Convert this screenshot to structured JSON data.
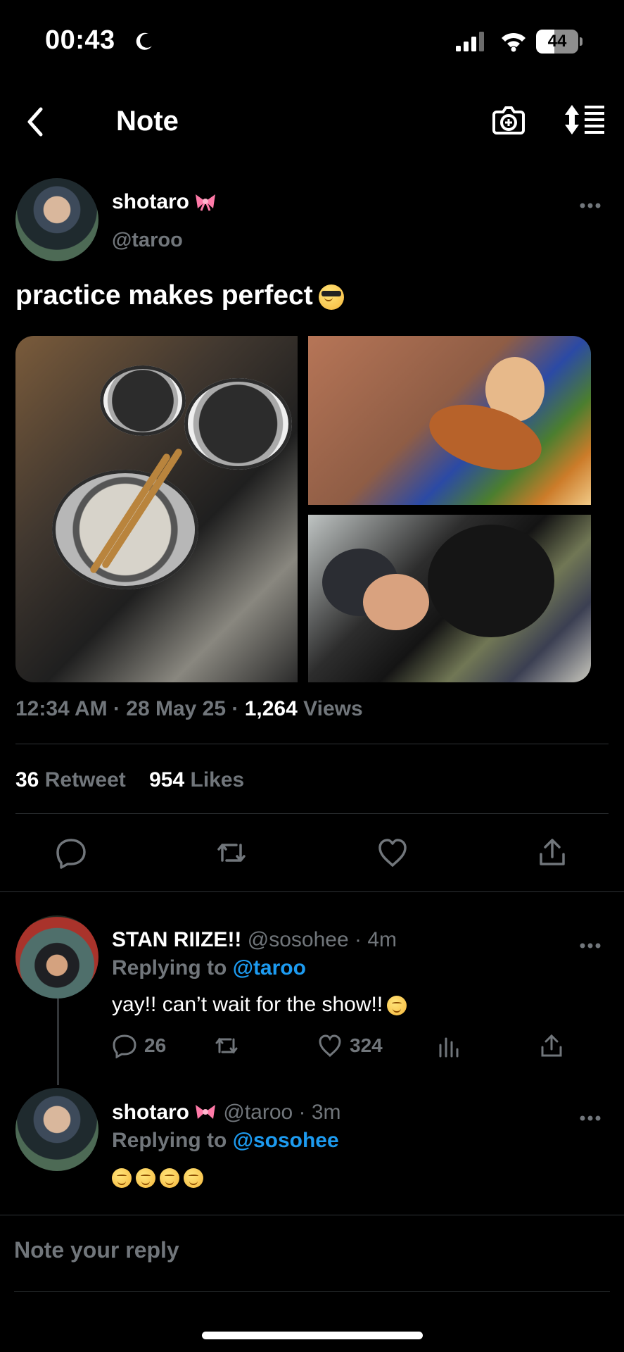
{
  "status_bar": {
    "time": "00:43",
    "battery": "44",
    "battery_level": 0.44
  },
  "nav": {
    "title": "Note"
  },
  "post": {
    "author_name": "shotaro",
    "author_handle": "@taroo",
    "text": "practice makes perfect",
    "timestamp": "12:34 AM · 28 May 25",
    "meta_separator": " · ",
    "views_count": "1,264",
    "views_label": "Views",
    "retweet_count": "36",
    "retweet_label": "Retweet",
    "likes_count": "954",
    "likes_label": "Likes"
  },
  "replies": [
    {
      "author_name": "STAN RIIZE!!",
      "author_handle": "@sosohee",
      "separator": " · ",
      "time": "4m",
      "replying_prefix": "Replying to",
      "replying_to": "@taroo",
      "text": "yay!! can’t wait for the show!!",
      "reply_count": "26",
      "like_count": "324"
    },
    {
      "author_name": "shotaro",
      "author_handle": "@taroo",
      "separator": " · ",
      "time": "3m",
      "replying_prefix": "Replying to",
      "replying_to": "@sosohee"
    }
  ],
  "reply_input": {
    "placeholder": "Note your reply"
  },
  "colors": {
    "accent": "#1d9bf0",
    "secondary_text": "#71767b",
    "divider": "#2f3336",
    "background": "#000000"
  },
  "icons": [
    "moon-icon",
    "signal-icon",
    "wifi-icon",
    "battery-icon",
    "back-icon",
    "camera-plus-icon",
    "sort-icon",
    "bow-icon",
    "more-icon",
    "reply-icon",
    "retweet-icon",
    "like-icon",
    "share-icon",
    "views-icon"
  ]
}
